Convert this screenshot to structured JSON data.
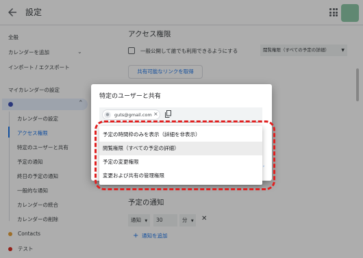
{
  "header": {
    "title": "設定"
  },
  "sidebar": {
    "general": "全般",
    "add_calendar": "カレンダーを追加",
    "import_export": "インポート / エクスポート",
    "my_calendar_settings": "マイカレンダーの設定",
    "sub_items": [
      {
        "label": "カレンダーの設定"
      },
      {
        "label": "アクセス権限"
      },
      {
        "label": "特定のユーザーと共有"
      },
      {
        "label": "予定の通知"
      },
      {
        "label": "終日の予定の通知"
      },
      {
        "label": "一般的な通知"
      },
      {
        "label": "カレンダーの統合"
      },
      {
        "label": "カレンダーの削除"
      }
    ],
    "other_calendars": [
      {
        "label": "Contacts",
        "color": "#e8a33d"
      },
      {
        "label": "テスト",
        "color": "#d93025"
      }
    ],
    "calendar_color": "#3f51b5"
  },
  "main": {
    "access_title": "アクセス権限",
    "public_label": "一般公開して誰でも利用できるようにする",
    "permission_select": "閲覧権限（すべての予定の詳細）",
    "share_link_button": "共有可能なリンクを取得",
    "notifications_title": "予定の通知",
    "notif_type": "通知",
    "notif_value": "30",
    "notif_unit": "分",
    "add_notification": "通知を追加"
  },
  "dialog": {
    "title": "特定のユーザーと共有",
    "chip_email": "guts@gmail.com"
  },
  "dropdown": {
    "options": [
      {
        "label": "予定の時間枠のみを表示（詳細を非表示）"
      },
      {
        "label": "閲覧権限（すべての予定の詳細）"
      },
      {
        "label": "予定の変更権限"
      },
      {
        "label": "変更および共有の管理権限"
      }
    ],
    "selected_index": 1
  },
  "colors": {
    "accent": "#1a73e8",
    "highlight": "#e02020"
  }
}
